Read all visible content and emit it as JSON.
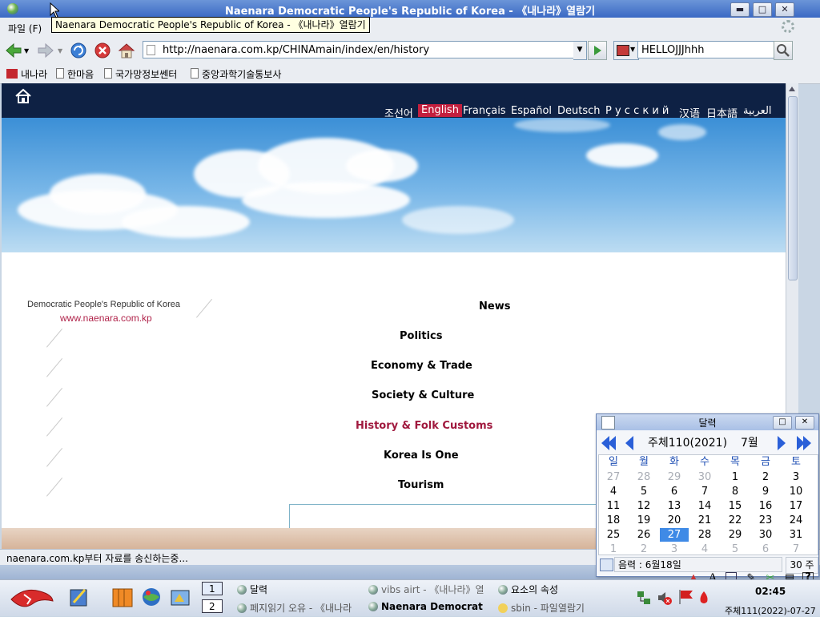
{
  "window": {
    "title": "Naenara Democratic People's Republic of Korea - 《내나라》열람기",
    "tooltip": "Naenara Democratic People's Republic of Korea - 《내나라》열람기",
    "minimize_label": "▬",
    "maximize_label": "□",
    "close_label": "✕"
  },
  "menu": {
    "file": "파일 (F)"
  },
  "toolbar": {
    "url": "http://naenara.com.kp/CHINAmain/index/en/history",
    "search_value": "HELLOJJJhhh"
  },
  "bookmarks": [
    "내나라",
    "한마음",
    "국가망정보쎈터",
    "중앙과학기술통보사"
  ],
  "site": {
    "languages": [
      "조선어",
      "English",
      "Français",
      "Español",
      "Deutsch",
      "Р у с с к и й",
      "汉语",
      "日本語",
      "العربية"
    ],
    "active_language": "English",
    "brand_line": "Democratic People's Republic of Korea",
    "brand_url": "www.naenara.com.kp",
    "nav": [
      "News",
      "Politics",
      "Economy & Trade",
      "Society & Culture",
      "History & Folk Customs",
      "Korea Is One",
      "Tourism"
    ],
    "active_nav": "History & Folk Customs",
    "accent_color": "#a0193e",
    "header_color": "#0e2144"
  },
  "status": {
    "text": "naenara.com.kp부터 자료를 송신하는중..."
  },
  "calendar": {
    "title": "달력",
    "year": "주체110(2021)",
    "month": "7월",
    "weekdays": [
      "일",
      "월",
      "화",
      "수",
      "목",
      "금",
      "토"
    ],
    "weeks": [
      [
        "27",
        "28",
        "29",
        "30",
        "1",
        "2",
        "3"
      ],
      [
        "4",
        "5",
        "6",
        "7",
        "8",
        "9",
        "10"
      ],
      [
        "11",
        "12",
        "13",
        "14",
        "15",
        "16",
        "17"
      ],
      [
        "18",
        "19",
        "20",
        "21",
        "22",
        "23",
        "24"
      ],
      [
        "25",
        "26",
        "27",
        "28",
        "29",
        "30",
        "31"
      ],
      [
        "1",
        "2",
        "3",
        "4",
        "5",
        "6",
        "7"
      ]
    ],
    "today": "27",
    "lunar": "음력 : 6월18일",
    "side_value": "30 주"
  },
  "taskbar": {
    "workspace_1": "1",
    "workspace_2": "2",
    "tasks": [
      "달력",
      "vibs airt - 《내나라》열",
      "요소의 속성",
      "페지읽기 오유 - 《내나라",
      "Naenara Democrat",
      "sbin - 파일열람기"
    ],
    "clock": "02:45",
    "date": "주체111(2022)-07-27"
  }
}
